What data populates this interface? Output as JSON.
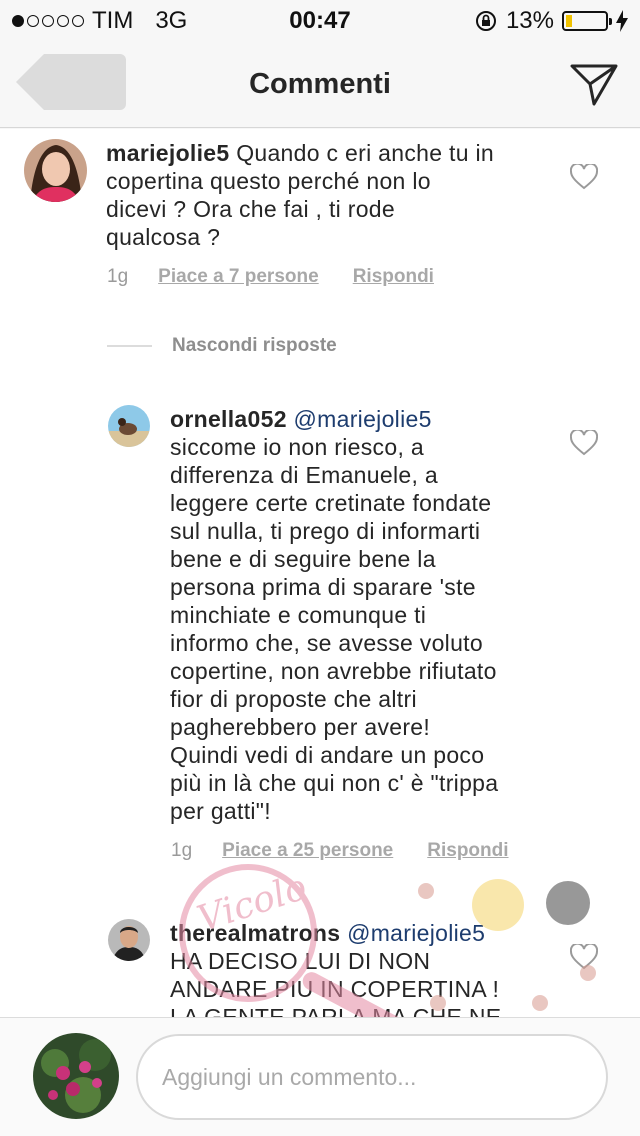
{
  "status_bar": {
    "carrier": "TIM",
    "network": "3G",
    "time": "00:47",
    "battery": "13%",
    "signal_strength": 1
  },
  "nav": {
    "title": "Commenti",
    "back_icon": "back-arrow-icon",
    "send_icon": "paper-plane-icon"
  },
  "comments": [
    {
      "username": "mariejolie5",
      "text": "Quando c eri anche tu in copertina questo perché non lo dicevi ?  Ora che fai , ti rode qualcosa ?",
      "lines": [
        "Quando c eri anche tu in",
        "copertina questo perché non lo",
        "dicevi ?  Ora che fai , ti rode",
        "qualcosa ?"
      ],
      "age": "1g",
      "likes": "Piace a 7 persone",
      "reply": "Rispondi"
    },
    {
      "username": "ornella052",
      "mention": "@mariejolie5",
      "lines": [
        "siccome io non riesco, a",
        "differenza di Emanuele,  a",
        "leggere certe cretinate fondate",
        "sul nulla, ti prego di informarti",
        "bene e di seguire bene la",
        "persona prima di sparare 'ste",
        "minchiate e comunque ti",
        "informo che, se avesse voluto",
        "copertine, non avrebbe rifiutato",
        "fior di proposte che altri",
        "pagherebbero per avere!",
        "Quindi vedi di andare un poco",
        "più in là che qui non c' è \"trippa",
        "per gatti\"!"
      ],
      "age": "1g",
      "likes": "Piace a 25 persone",
      "reply": "Rispondi"
    },
    {
      "username": "therealmatrons",
      "mention": "@mariejolie5",
      "lines": [
        "HA DECISO LUI DI NON",
        "ANDARE PIU IN COPERTINA !",
        "LA GENTE PARLA MA CHE NE"
      ]
    }
  ],
  "hide_replies": "Nascondi risposte",
  "input": {
    "placeholder": "Aggiungi un commento..."
  },
  "watermark": {
    "text": "Vicolo"
  },
  "colors": {
    "mention": "#1d3c6e",
    "meta": "#9a9a9a",
    "battery": "#f0c200"
  }
}
